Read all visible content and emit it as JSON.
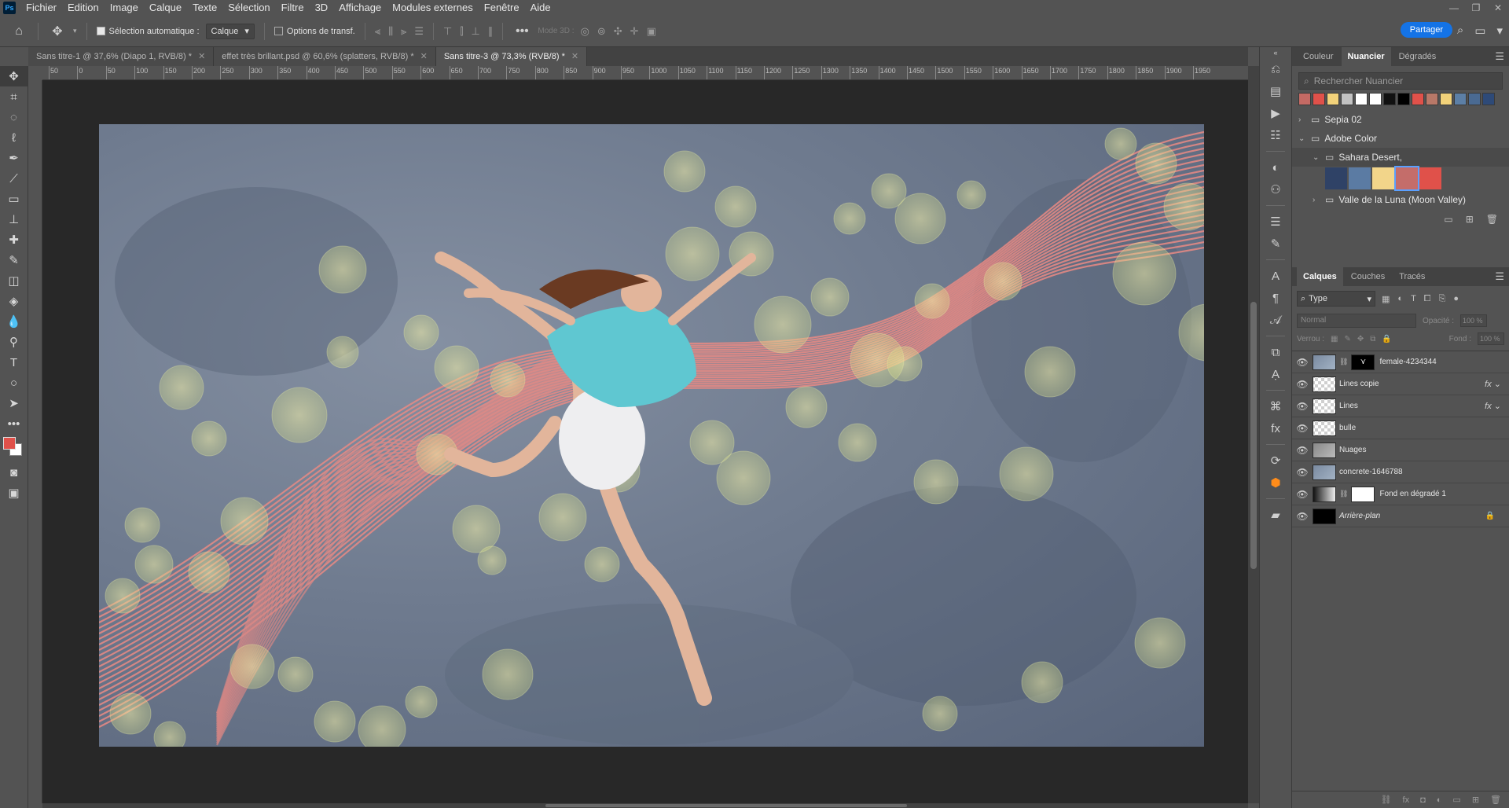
{
  "app": {
    "logo": "Ps",
    "menu": [
      "Fichier",
      "Edition",
      "Image",
      "Calque",
      "Texte",
      "Sélection",
      "Filtre",
      "3D",
      "Affichage",
      "Modules externes",
      "Fenêtre",
      "Aide"
    ]
  },
  "options_bar": {
    "auto_select_label": "Sélection automatique :",
    "auto_select_target": "Calque",
    "transform_options_label": "Options de transf.",
    "mode3d_label": "Mode 3D :",
    "share_label": "Partager"
  },
  "tabs": [
    {
      "title": "Sans titre-1 @ 37,6% (Diapo 1, RVB/8) *",
      "active": false
    },
    {
      "title": "effet très brillant.psd @ 60,6% (splatters, RVB/8) *",
      "active": false
    },
    {
      "title": "Sans titre-3 @ 73,3% (RVB/8) *",
      "active": true
    }
  ],
  "ruler": {
    "h_labels": [
      "50",
      "0",
      "50",
      "100",
      "150",
      "200",
      "250",
      "300",
      "350",
      "400",
      "450",
      "500",
      "550",
      "600",
      "650",
      "700",
      "750",
      "800",
      "850",
      "900",
      "950",
      "1000",
      "1050",
      "1100",
      "1150",
      "1200",
      "1250",
      "1300",
      "1350",
      "1400",
      "1450",
      "1500",
      "1550",
      "1600",
      "1650",
      "1700",
      "1750",
      "1800",
      "1850",
      "1900",
      "1950"
    ]
  },
  "swatches_panel": {
    "tabs": [
      "Couleur",
      "Nuancier",
      "Dégradés"
    ],
    "active_tab": "Nuancier",
    "search_placeholder": "Rechercher Nuancier",
    "recent_colors": [
      "#c46a64",
      "#e0514a",
      "#f2d27a",
      "#c2c2c2",
      "#ffffff",
      "#ffffff",
      "#111111",
      "#000000",
      "#e0514a",
      "#b87868",
      "#f2d27a",
      "#5c7fa6",
      "#4a6a92",
      "#2e4a78"
    ],
    "groups": [
      {
        "name": "Sepia 02",
        "expanded": false,
        "level": 0
      },
      {
        "name": "Adobe Color",
        "expanded": true,
        "level": 0
      },
      {
        "name": "Sahara Desert,",
        "expanded": true,
        "level": 1
      },
      {
        "name": "Valle de la Luna (Moon Valley)",
        "expanded": false,
        "level": 1
      }
    ],
    "sahara_colors": [
      "#2f4266",
      "#5b7ba3",
      "#f2d58a",
      "#c46d6a",
      "#e0514a"
    ]
  },
  "layers_panel": {
    "tabs": [
      "Calques",
      "Couches",
      "Tracés"
    ],
    "active_tab": "Calques",
    "filter_type": "Type",
    "blend_mode": "Normal",
    "opacity_label": "Opacité :",
    "opacity_value": "100 %",
    "lock_label": "Verrou :",
    "fill_label": "Fond :",
    "fill_value": "100 %",
    "layers": [
      {
        "name": "female-4234344",
        "thumb": "img",
        "mask": "dark",
        "fx": false,
        "locked": false,
        "italic": false
      },
      {
        "name": "Lines copie",
        "thumb": "check",
        "mask": "",
        "fx": true,
        "locked": false,
        "italic": false
      },
      {
        "name": "Lines",
        "thumb": "check",
        "mask": "",
        "fx": true,
        "locked": false,
        "italic": false
      },
      {
        "name": "bulle",
        "thumb": "check",
        "mask": "",
        "fx": false,
        "locked": false,
        "italic": false
      },
      {
        "name": "Nuages",
        "thumb": "grey",
        "mask": "",
        "fx": false,
        "locked": false,
        "italic": false
      },
      {
        "name": "concrete-1646788",
        "thumb": "img",
        "mask": "",
        "fx": false,
        "locked": false,
        "italic": false
      },
      {
        "name": "Fond en dégradé 1",
        "thumb": "grad",
        "mask": "white",
        "fx": false,
        "locked": false,
        "italic": false
      },
      {
        "name": "Arrière-plan",
        "thumb": "black",
        "mask": "",
        "fx": false,
        "locked": true,
        "italic": true
      }
    ]
  },
  "colors": {
    "foreground": "#e0514a",
    "background": "#ffffff",
    "accent": "#1473e6"
  }
}
